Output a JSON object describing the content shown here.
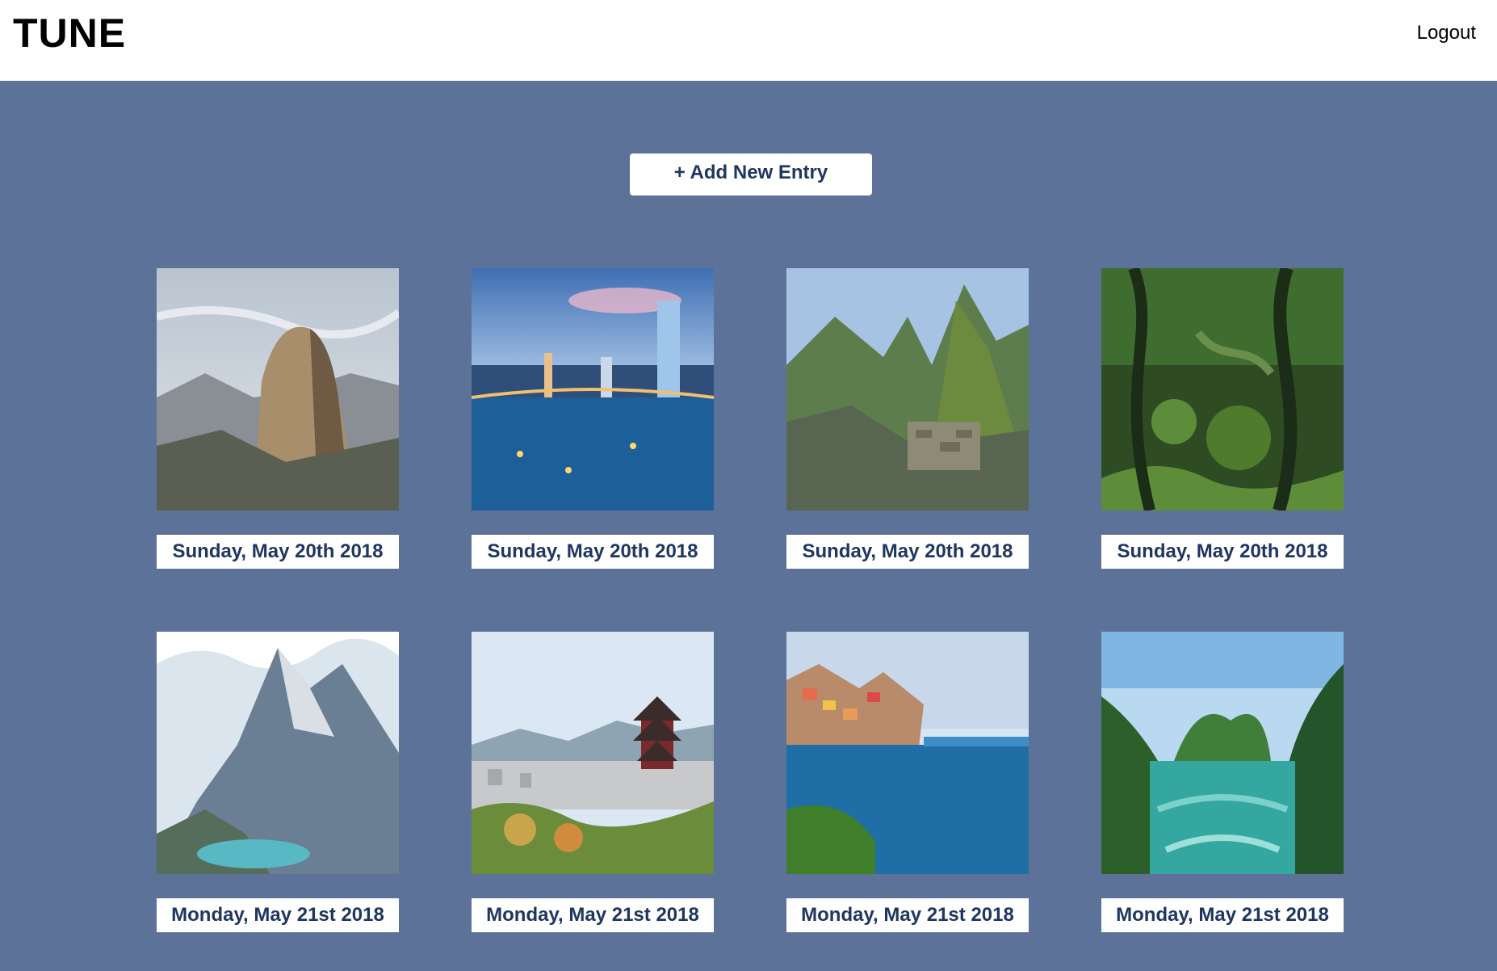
{
  "header": {
    "logo": "TUNE",
    "logout_label": "Logout"
  },
  "main": {
    "add_entry_label": "+ Add New Entry",
    "entries": [
      {
        "date": "Sunday, May 20th 2018"
      },
      {
        "date": "Sunday, May 20th 2018"
      },
      {
        "date": "Sunday, May 20th 2018"
      },
      {
        "date": "Sunday, May 20th 2018"
      },
      {
        "date": "Monday, May 21st 2018"
      },
      {
        "date": "Monday, May 21st 2018"
      },
      {
        "date": "Monday, May 21st 2018"
      },
      {
        "date": "Monday, May 21st 2018"
      }
    ]
  },
  "colors": {
    "background": "#5d7299",
    "header_bg": "#ffffff",
    "accent_text": "#1f3661"
  }
}
